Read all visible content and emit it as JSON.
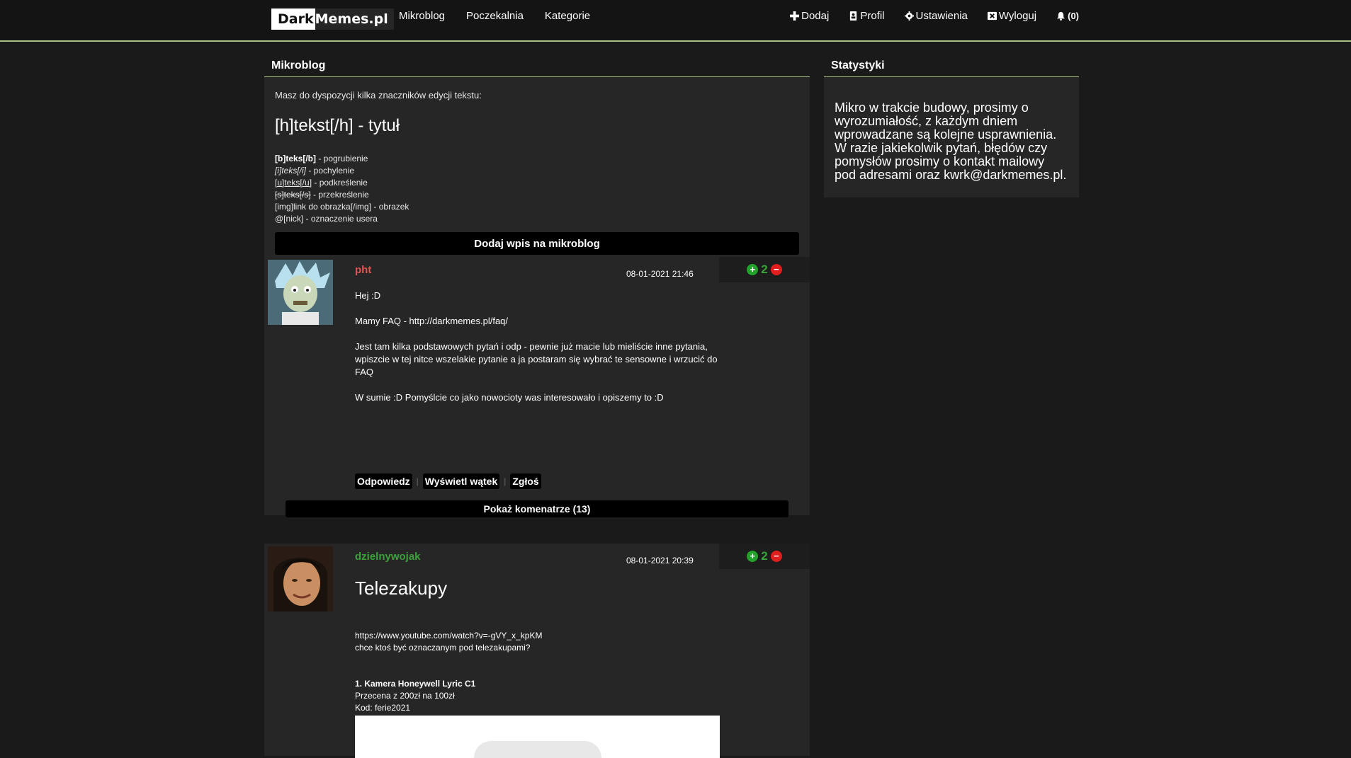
{
  "nav": {
    "logo_dark": "Dark",
    "logo_memes": "Memes.pl",
    "left": [
      "Mikroblog",
      "Poczekalnia",
      "Kategorie"
    ],
    "add": "Dodaj",
    "profile": "Profil",
    "settings": "Ustawienia",
    "logout": "Wyloguj",
    "notifications": "(0)"
  },
  "main": {
    "title": "Mikroblog",
    "help_intro": "Masz do dyspozycji kilka znaczników edycji tekstu:",
    "help_heading": "[h]tekst[/h] - tytuł",
    "help_items": [
      {
        "code": "[b]teks[/b]",
        "desc": " - pogrubienie"
      },
      {
        "code": "[i]teks[/i]",
        "desc": " - pochylenie"
      },
      {
        "code": "[u]teks[/u]",
        "desc": " - podkreślenie"
      },
      {
        "code": "[s]teks[/s]",
        "desc": " - przekreślenie"
      },
      {
        "code": "[img]link do obrazka[/img]",
        "desc": " - obrazek"
      },
      {
        "code": "@[nick]",
        "desc": " - oznaczenie usera"
      }
    ],
    "add_post_button": "Dodaj wpis na mikroblog"
  },
  "posts": [
    {
      "author": "pht",
      "date": "08-01-2021 21:46",
      "votes": "2",
      "paragraphs": [
        "Hej :D",
        "Mamy FAQ - http://darkmemes.pl/faq/",
        "Jest tam kilka podstawowych pytań i odp - pewnie już macie lub mieliście inne pytania, wpiszcie w tej nitce wszelakie pytanie a ja postaram się wybrać te sensowne i wrzucić do FAQ",
        "W sumie :D Pomyślcie co jako nowocioty was interesowało i opiszemy to :D"
      ],
      "actions": [
        "Odpowiedz",
        "Wyświetl wątek",
        "Zgłoś"
      ],
      "comments_button": "Pokaż komenatrze (13)"
    },
    {
      "author": "dzielnywojak",
      "date": "08-01-2021 20:39",
      "votes": "2",
      "title": "Telezakupy",
      "lines": [
        "https://www.youtube.com/watch?v=-gVY_x_kpKM",
        "chce ktoś być oznaczanym pod telezakupami?"
      ],
      "item_title": "1. Kamera Honeywell Lyric C1",
      "item_lines": [
        "Przecena z 200zł na 100zł",
        "Kod: ferie2021"
      ]
    }
  ],
  "sidebar": {
    "title": "Statystyki",
    "text": "Mikro w trakcie budowy, prosimy o wyrozumiałość, z każdym dniem wprowadzane są kolejne usprawnienia. W razie jakiekolwik pytań, błędów czy pomysłów prosimy o kontakt mailowy pod adresami oraz kwrk@darkmemes.pl."
  }
}
